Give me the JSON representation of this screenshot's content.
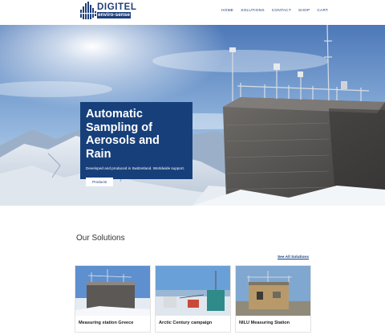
{
  "brand": {
    "name": "DIGITEL",
    "tagline": "enviro-sense"
  },
  "nav": {
    "items": [
      "HOME",
      "SOLUTIONS",
      "CONTACT",
      "SHOP",
      "CART"
    ]
  },
  "hero": {
    "title": "Automatic Sampling of Aerosols and Rain",
    "subtitle": "Developed and produced in Switzerland. Worldwide support.",
    "button": "Products"
  },
  "solutions": {
    "heading": "Our Solutions",
    "see_all": "See All Solutions",
    "cards": [
      {
        "caption": "Measuring station Greece"
      },
      {
        "caption": "Arctic Century campaign"
      },
      {
        "caption": "NILU Measuring Station"
      }
    ]
  },
  "colors": {
    "brand_blue": "#17407b"
  }
}
